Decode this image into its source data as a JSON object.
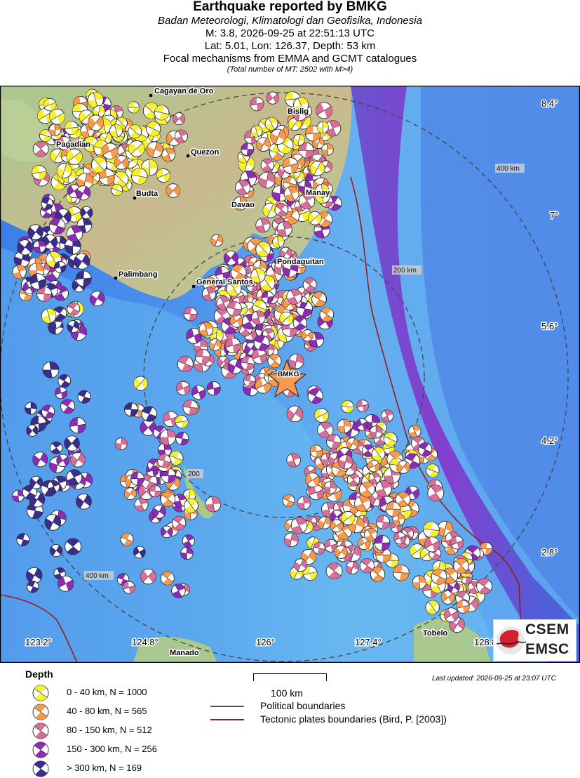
{
  "header": {
    "title": "Earthquake reported by BMKG",
    "agency": "Badan Meteorologi, Klimatologi dan Geofisika, Indonesia",
    "event_line": "M: 3.8,  2026-09-25 at 22:51:13 UTC",
    "location_line": "Lat: 5.01, Lon: 126.37, Depth: 53 km",
    "mechanisms_line": "Focal mechanisms from EMMA and GCMT catalogues",
    "total_note": "(Total number of MT: 2502 with M>4)"
  },
  "map": {
    "epicenter_label": "BMKG",
    "cities": [
      {
        "name": "Cagayan de Oro"
      },
      {
        "name": "Bislig"
      },
      {
        "name": "Pagadian"
      },
      {
        "name": "Quezon"
      },
      {
        "name": "Budta"
      },
      {
        "name": "Manay"
      },
      {
        "name": "Davao"
      },
      {
        "name": "Pondaguitan"
      },
      {
        "name": "Palimbang"
      },
      {
        "name": "General Santos"
      },
      {
        "name": "Tobelo"
      },
      {
        "name": "Manado"
      }
    ],
    "lat_labels": [
      "8.4°",
      "7°",
      "5.6°",
      "4.2°",
      "2.8°"
    ],
    "lon_labels": [
      "123.2°",
      "124.8°",
      "126°",
      "127.4°",
      "128.8°"
    ],
    "ring_labels": [
      "400 km",
      "200 km",
      "200",
      "400 km"
    ],
    "colors": {
      "depth_0_40": "#f5f032",
      "depth_40_80": "#f79a4e",
      "depth_80_150": "#d96e98",
      "depth_150_300": "#8c2cb5",
      "depth_300_plus": "#3a2d8c",
      "political_boundary": "#555555",
      "plate_boundary": "#9b1a1a",
      "epicenter_star": "#f79a4e"
    }
  },
  "legend": {
    "depth_title": "Depth",
    "depth_items": [
      {
        "label": "0 - 40 km, N = 1000",
        "color": "#f5f032"
      },
      {
        "label": "40 - 80 km, N = 565",
        "color": "#f79a4e"
      },
      {
        "label": "80 - 150 km, N = 512",
        "color": "#d96e98"
      },
      {
        "label": "150 - 300 km, N = 256",
        "color": "#8c2cb5"
      },
      {
        "label": "> 300 km, N = 169",
        "color": "#3a2d8c"
      }
    ],
    "scale_label": "100 km",
    "political_label": "Political boundaries",
    "tectonic_label": "Tectonic plates boundaries (Bird, P. [2003])",
    "last_updated": "Last updated: 2026-09-25 at 23:07 UTC"
  },
  "logo": {
    "top": "CSEM",
    "bottom": "EMSC"
  }
}
